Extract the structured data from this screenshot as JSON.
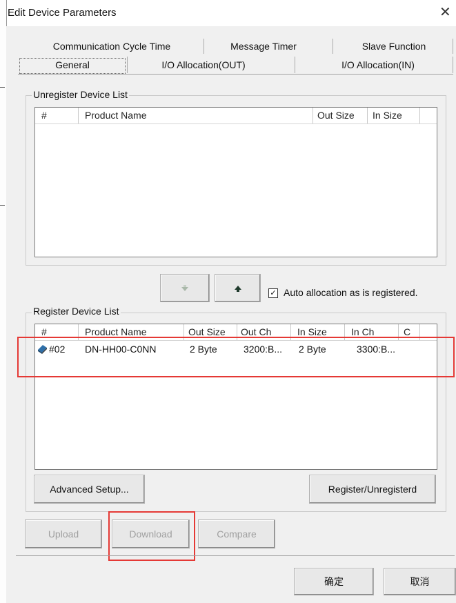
{
  "dialog": {
    "title": "Edit Device Parameters",
    "close_glyph": "✕"
  },
  "tabs": {
    "row1": [
      "Communication Cycle Time",
      "Message Timer",
      "Slave Function"
    ],
    "row2": [
      "General",
      "I/O Allocation(OUT)",
      "I/O Allocation(IN)"
    ],
    "selected": "General"
  },
  "unregister": {
    "label": "Unregister Device List",
    "columns": [
      "#",
      "Product Name",
      "Out Size",
      "In Size"
    ]
  },
  "move_buttons": {
    "down_icon": "arrow-down-icon",
    "up_icon": "arrow-up-icon"
  },
  "auto_alloc": {
    "label": "Auto allocation as is registered.",
    "checked": true,
    "mark": "✓"
  },
  "register": {
    "label": "Register Device List",
    "columns": [
      "#",
      "Product Name",
      "Out Size",
      "Out Ch",
      "In Size",
      "In Ch",
      "C"
    ],
    "rows": [
      {
        "icon": "device-icon",
        "num": "#02",
        "product": "DN-HH00-C0NN",
        "out_size": "2 Byte",
        "out_ch": "3200:B...",
        "in_size": "2 Byte",
        "in_ch": "3300:B..."
      }
    ]
  },
  "buttons": {
    "advanced": "Advanced Setup...",
    "register_unregister": "Register/Unregisterd",
    "upload": "Upload",
    "download": "Download",
    "compare": "Compare",
    "ok": "确定",
    "cancel": "取消"
  },
  "colors": {
    "highlight": "#e53935",
    "dialog_bg": "#f0f0f0"
  }
}
